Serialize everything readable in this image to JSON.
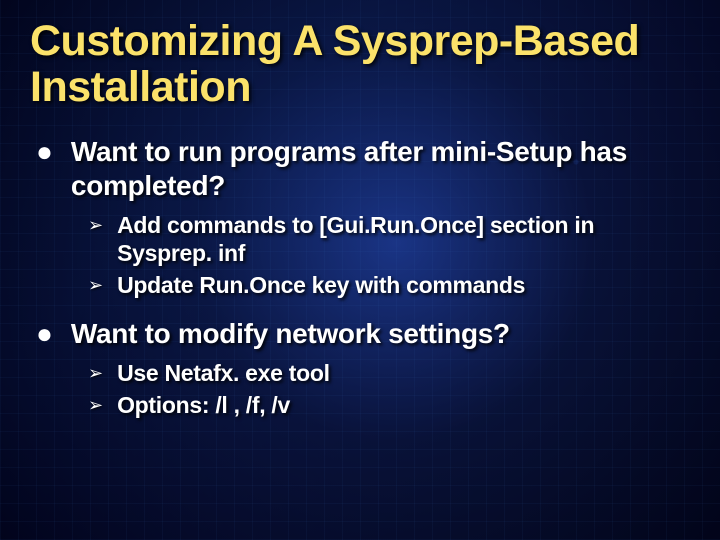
{
  "title": "Customizing A Sysprep-Based Installation",
  "items": [
    {
      "text": "Want to run programs after mini-Setup has completed?",
      "sub": [
        "Add commands to [Gui.Run.Once] section in Sysprep. inf",
        "Update Run.Once key with commands"
      ]
    },
    {
      "text": "Want to modify network settings?",
      "sub": [
        "Use Netafx. exe tool",
        "Options:  /l , /f, /v"
      ]
    }
  ]
}
